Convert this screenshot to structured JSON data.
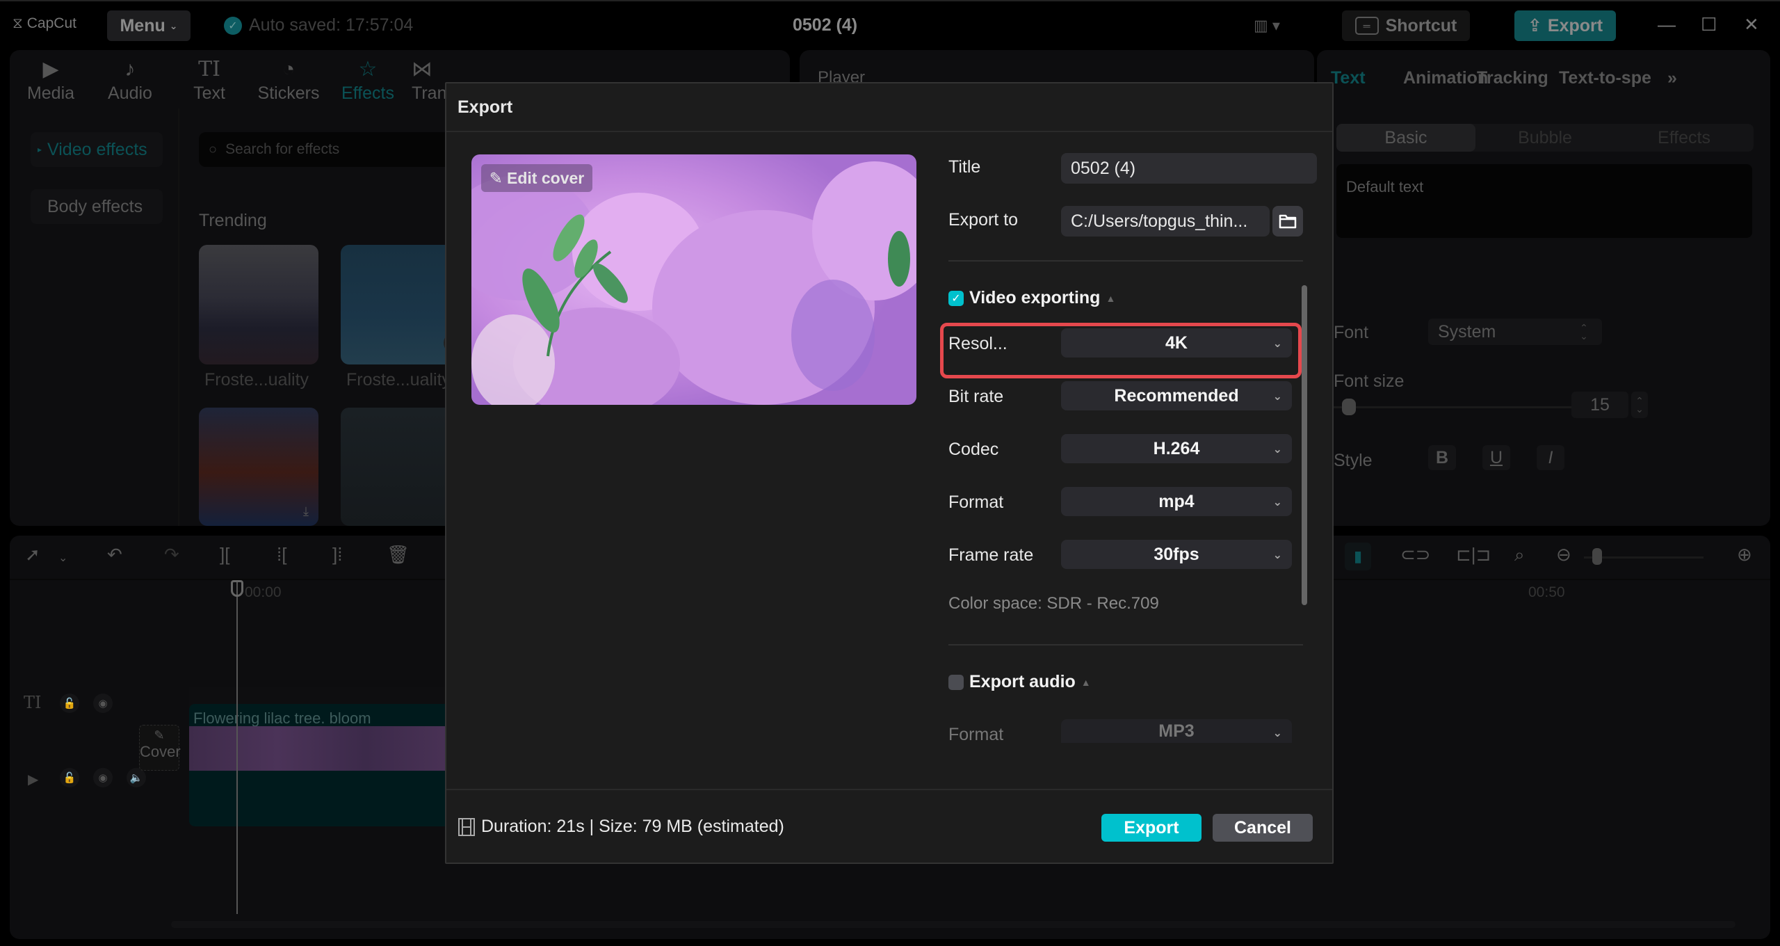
{
  "app": {
    "name": "CapCut",
    "menu_label": "Menu",
    "autosave_text": "Auto saved: 17:57:04",
    "document_title": "0502 (4)",
    "shortcut_label": "Shortcut",
    "export_label": "Export",
    "accent_color": "#00c1cd"
  },
  "toolbar": {
    "items": [
      {
        "label": "Media",
        "icon": "media-icon"
      },
      {
        "label": "Audio",
        "icon": "audio-icon"
      },
      {
        "label": "Text",
        "icon": "text-icon"
      },
      {
        "label": "Stickers",
        "icon": "stickers-icon"
      },
      {
        "label": "Effects",
        "icon": "effects-icon",
        "active": true
      },
      {
        "label": "Tran",
        "icon": "transitions-icon"
      },
      {
        "label": "",
        "icon": "captions-icon"
      },
      {
        "label": "",
        "icon": "filters-icon"
      },
      {
        "label": "",
        "icon": "adjustment-icon"
      }
    ]
  },
  "effects_panel": {
    "sidebar": [
      {
        "label": "Video effects",
        "active": true
      },
      {
        "label": "Body effects"
      }
    ],
    "search_placeholder": "Search for effects",
    "section_title": "Trending",
    "items": [
      {
        "label": "Froste...uality"
      },
      {
        "label": "Froste...uality"
      },
      {
        "label": ""
      },
      {
        "label": ""
      }
    ]
  },
  "player": {
    "title": "Player"
  },
  "right_panel": {
    "tabs": [
      "Text",
      "Animation",
      "Tracking",
      "Text-to-spe"
    ],
    "active_tab": "Text",
    "subtabs": [
      "Basic",
      "Bubble",
      "Effects"
    ],
    "active_subtab": "Basic",
    "text_value": "Default text",
    "font_label": "Font",
    "font_value": "System",
    "font_size_label": "Font size",
    "font_size_value": "15",
    "style_label": "Style",
    "style_buttons": [
      "B",
      "U",
      "I"
    ]
  },
  "timeline": {
    "start_time": "00:00",
    "marker_time": "00:50",
    "clip_label": "Flowering lilac tree. bloom",
    "cover_label": "Cover"
  },
  "dialog": {
    "title": "Export",
    "edit_cover_label": "Edit cover",
    "title_label": "Title",
    "title_value": "0502 (4)",
    "export_to_label": "Export to",
    "export_to_value": "C:/Users/topgus_thin...",
    "video_section": {
      "label": "Video exporting",
      "checked": true,
      "rows": [
        {
          "label": "Resol...",
          "value": "4K"
        },
        {
          "label": "Bit rate",
          "value": "Recommended"
        },
        {
          "label": "Codec",
          "value": "H.264"
        },
        {
          "label": "Format",
          "value": "mp4"
        },
        {
          "label": "Frame rate",
          "value": "30fps"
        }
      ],
      "color_space": "Color space: SDR - Rec.709"
    },
    "audio_section": {
      "label": "Export audio",
      "checked": false,
      "rows": [
        {
          "label": "Format",
          "value": "MP3"
        }
      ]
    },
    "footer_info": "Duration: 21s | Size: 79 MB (estimated)",
    "export_button": "Export",
    "cancel_button": "Cancel",
    "highlight_color": "#e5484d"
  }
}
